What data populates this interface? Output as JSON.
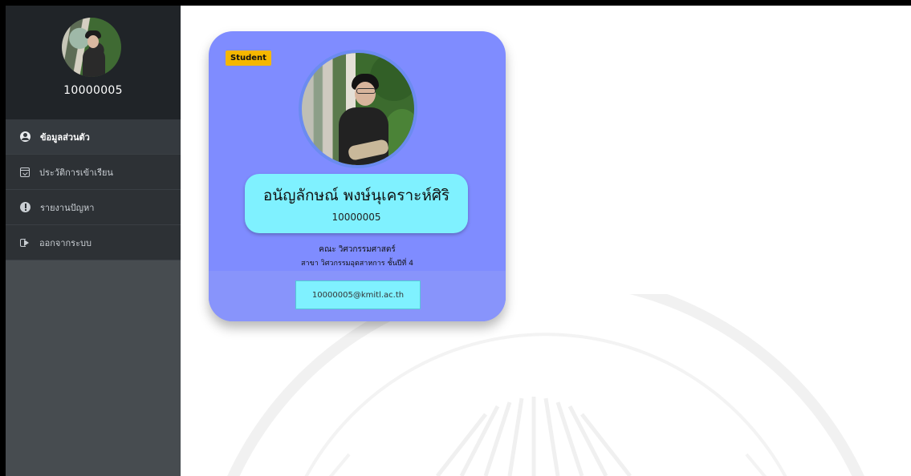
{
  "sidebar": {
    "user_id": "10000005",
    "items": [
      {
        "label": "ข้อมูลส่วนตัว",
        "icon": "user-circle-icon",
        "active": true
      },
      {
        "label": "ประวัติการเข้าเรียน",
        "icon": "calendar-check-icon",
        "active": false
      },
      {
        "label": "รายงานปัญหา",
        "icon": "exclamation-circle-icon",
        "active": false
      },
      {
        "label": "ออกจากระบบ",
        "icon": "sign-out-icon",
        "active": false
      }
    ]
  },
  "card": {
    "badge": "Student",
    "name": "อนัญลักษณ์ พงษ์นุเคราะห์ศิริ",
    "student_id": "10000005",
    "faculty": "คณะ วิศวกรรมศาสตร์",
    "major": "สาขา วิศวกรรมอุตสาหการ ชั้นปีที่ 4",
    "email": "10000005@kmitl.ac.th"
  },
  "colors": {
    "sidebar_dark": "#202428",
    "sidebar_menu": "#2d3135",
    "card_bg": "#7f8cff",
    "name_box": "#7ff1ff",
    "badge": "#f5b700"
  }
}
